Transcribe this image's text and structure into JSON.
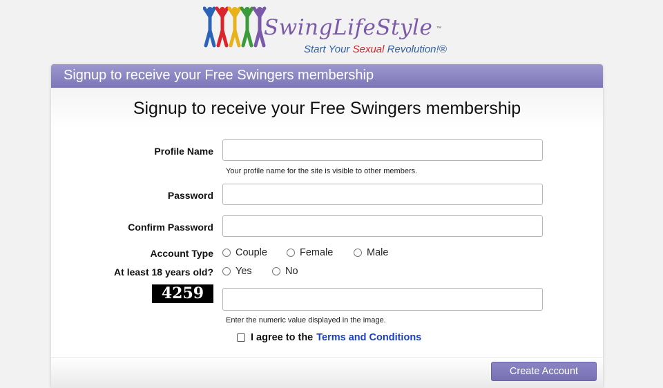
{
  "logo": {
    "brand": "SwingLifeStyle",
    "tm": "™",
    "tagline_start": "Start Your ",
    "tagline_highlight": "Sexual",
    "tagline_end": " Revolution!®"
  },
  "panel": {
    "header": "Signup to receive your Free Swingers membership",
    "title": "Signup to receive your Free Swingers membership"
  },
  "form": {
    "profile_name": {
      "label": "Profile Name",
      "value": "",
      "help": "Your profile name for the site is visible to other members."
    },
    "password": {
      "label": "Password",
      "value": ""
    },
    "confirm_password": {
      "label": "Confirm Password",
      "value": ""
    },
    "account_type": {
      "label": "Account Type",
      "options": [
        "Couple",
        "Female",
        "Male"
      ]
    },
    "age": {
      "label": "At least 18 years old?",
      "options": [
        "Yes",
        "No"
      ]
    },
    "captcha": {
      "code": "4259",
      "value": "",
      "help": "Enter the numeric value displayed in the image."
    },
    "agree": {
      "text": "I agree to the",
      "link": "Terms and Conditions"
    },
    "submit": "Create Account"
  }
}
